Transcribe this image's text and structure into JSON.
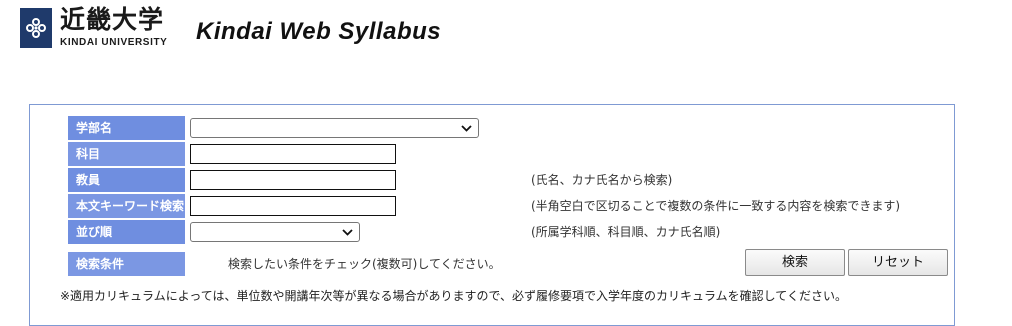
{
  "header": {
    "logo_jp": "近畿大学",
    "logo_en": "KINDAI UNIVERSITY",
    "title": "Kindai Web Syllabus"
  },
  "form": {
    "faculty_label": "学部名",
    "faculty_value": "",
    "subject_label": "科目",
    "subject_value": "",
    "teacher_label": "教員",
    "teacher_value": "",
    "teacher_hint": "(氏名、カナ氏名から検索)",
    "keyword_label": "本文キーワード検索",
    "keyword_value": "",
    "keyword_hint": "(半角空白で区切ることで複数の条件に一致する内容を検索できます)",
    "sort_label": "並び順",
    "sort_value": "",
    "sort_hint": "(所属学科順、科目順、カナ氏名順)",
    "conditions_label": "検索条件",
    "conditions_text": "検索したい条件をチェック(複数可)してください。",
    "search_button": "検索",
    "reset_button": "リセット",
    "note": "※適用カリキュラムによっては、単位数や開講年次等が異なる場合がありますので、必ず履修要項で入学年度のカリキュラムを確認してください。"
  },
  "colors": {
    "label_bg": "#6f8ee0",
    "panel_border": "#7f9ad3",
    "logo_bg": "#1f3a6b"
  }
}
